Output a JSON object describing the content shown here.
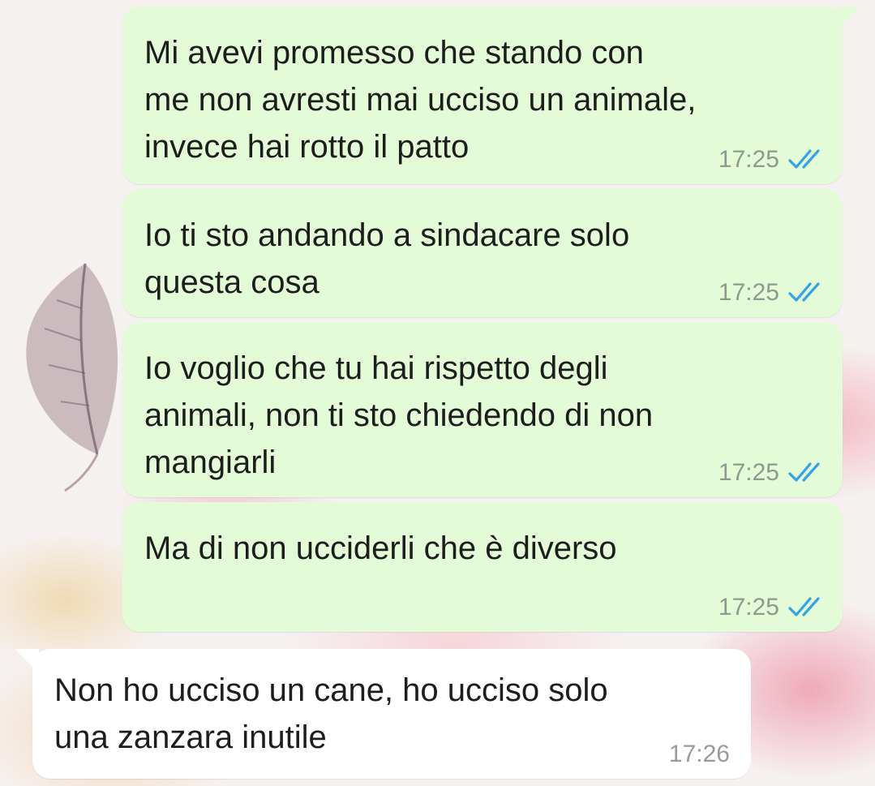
{
  "colors": {
    "outgoing_bubble": "#e4fbd8",
    "incoming_bubble": "#ffffff",
    "read_ticks": "#34a3e4",
    "timestamp": "#8e9a8e"
  },
  "messages": [
    {
      "direction": "outgoing",
      "text": "Mi avevi promesso che stando con\nme non avresti mai ucciso un animale,\ninvece hai rotto il patto",
      "time": "17:25",
      "status_icon": "double-check-read-icon"
    },
    {
      "direction": "outgoing",
      "text": "Io ti sto andando a sindacare solo\nquesta cosa",
      "time": "17:25",
      "status_icon": "double-check-read-icon"
    },
    {
      "direction": "outgoing",
      "text": "Io voglio che tu hai rispetto degli\nanimali, non ti sto chiedendo di non\nmangiarli",
      "time": "17:25",
      "status_icon": "double-check-read-icon"
    },
    {
      "direction": "outgoing",
      "text": "Ma di non ucciderli che è diverso",
      "time": "17:25",
      "status_icon": "double-check-read-icon"
    },
    {
      "direction": "incoming",
      "text": "Non ho ucciso un cane, ho ucciso solo\nuna zanzara inutile",
      "time": "17:26"
    }
  ]
}
